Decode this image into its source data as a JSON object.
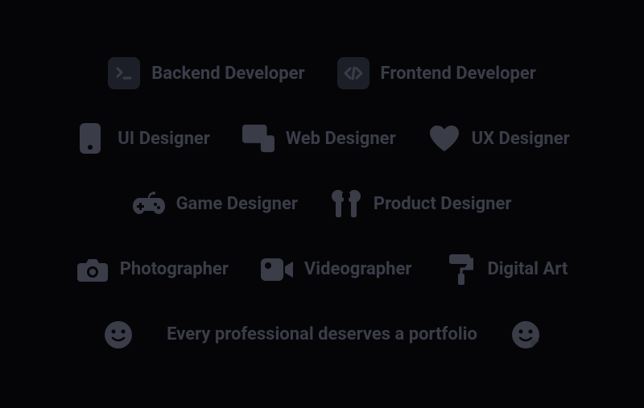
{
  "rows": {
    "r1": {
      "backend": "Backend Developer",
      "frontend": "Frontend Developer"
    },
    "r2": {
      "ui": "UI Designer",
      "web": "Web Designer",
      "ux": "UX Designer"
    },
    "r3": {
      "game": "Game Designer",
      "product": "Product Designer"
    },
    "r4": {
      "photo": "Photographer",
      "video": "Videographer",
      "digital": "Digital Art"
    },
    "r5": {
      "tagline": "Every professional deserves a portfolio"
    }
  }
}
